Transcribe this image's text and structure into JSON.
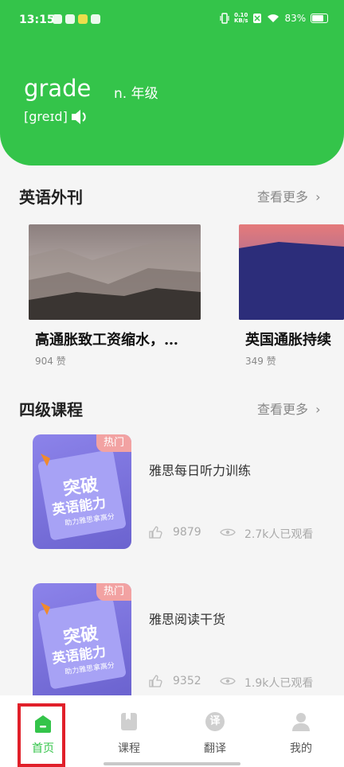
{
  "status": {
    "time": "13:15",
    "net_speed_value": "0.10",
    "net_speed_unit": "KB/s",
    "battery": "83%"
  },
  "word_card": {
    "word": "grade",
    "pos_meaning": "n. 年级",
    "phonetic": "[greɪd]"
  },
  "magazine": {
    "title": "英语外刊",
    "see_more": "查看更多",
    "articles": [
      {
        "title": "高通胀致工资缩水，…",
        "likes": "904 赞"
      },
      {
        "title": "英国通胀持续",
        "likes": "349 赞"
      }
    ]
  },
  "courses": {
    "title": "四级课程",
    "see_more": "查看更多",
    "items": [
      {
        "badge": "热门",
        "cover_line1": "突破",
        "cover_line2": "英语能力",
        "cover_line3": "助力雅思拿高分",
        "title": "雅思每日听力训练",
        "likes": "9879",
        "views": "2.7k人已观看"
      },
      {
        "badge": "热门",
        "cover_line1": "突破",
        "cover_line2": "英语能力",
        "cover_line3": "助力雅思拿高分",
        "title": "雅思阅读干货",
        "likes": "9352",
        "views": "1.9k人已观看"
      }
    ]
  },
  "tabbar": {
    "tabs": [
      {
        "label": "首页",
        "active": true
      },
      {
        "label": "课程"
      },
      {
        "label": "翻译"
      },
      {
        "label": "我的"
      }
    ],
    "translate_glyph": "译"
  },
  "colors": {
    "accent": "#34c44a",
    "highlight_box": "#e1202a"
  }
}
